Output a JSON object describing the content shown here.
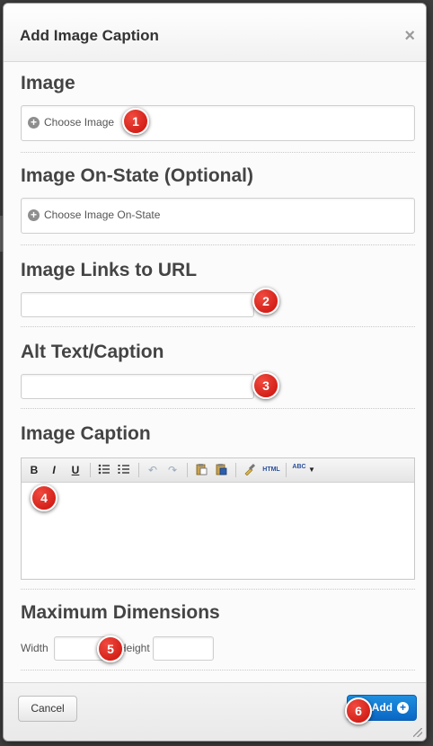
{
  "dialog": {
    "title": "Add Image Caption",
    "close_label": "×"
  },
  "sections": {
    "image": {
      "title": "Image",
      "choose_label": "Choose Image"
    },
    "image_on_state": {
      "title": "Image On-State (Optional)",
      "choose_label": "Choose Image On-State"
    },
    "links_to_url": {
      "title": "Image Links to URL",
      "value": ""
    },
    "alt_text": {
      "title": "Alt Text/Caption",
      "value": ""
    },
    "image_caption": {
      "title": "Image Caption",
      "toolbar": {
        "bold": "B",
        "italic": "I",
        "underline": "U",
        "html": "HTML",
        "abc": "ABC"
      },
      "content": ""
    },
    "max_dimensions": {
      "title": "Maximum Dimensions",
      "width_label": "Width",
      "height_label": "Height",
      "width_value": "",
      "height_value": ""
    }
  },
  "footer": {
    "cancel_label": "Cancel",
    "add_label": "Add"
  },
  "annotations": [
    "1",
    "2",
    "3",
    "4",
    "5",
    "6"
  ],
  "colors": {
    "primary_button": "#0a67c4",
    "badge": "#d21d14"
  }
}
